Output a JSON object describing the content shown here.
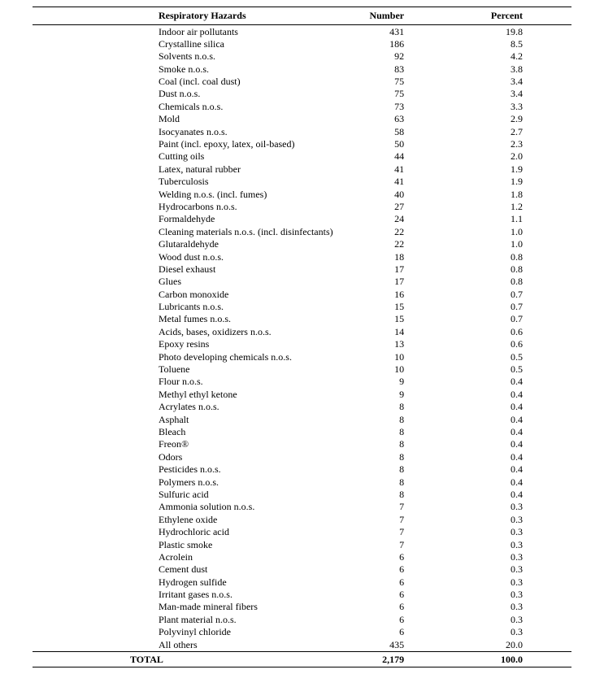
{
  "chart_data": {
    "type": "table",
    "headers": {
      "hazard": "Respiratory Hazards",
      "number": "Number",
      "percent": "Percent"
    },
    "rows": [
      {
        "hazard": "Indoor air pollutants",
        "number": "431",
        "percent": "19.8"
      },
      {
        "hazard": "Crystalline silica",
        "number": "186",
        "percent": "8.5"
      },
      {
        "hazard": "Solvents n.o.s.",
        "number": "92",
        "percent": "4.2"
      },
      {
        "hazard": "Smoke n.o.s.",
        "number": "83",
        "percent": "3.8"
      },
      {
        "hazard": "Coal (incl. coal dust)",
        "number": "75",
        "percent": "3.4"
      },
      {
        "hazard": "Dust n.o.s.",
        "number": "75",
        "percent": "3.4"
      },
      {
        "hazard": "Chemicals n.o.s.",
        "number": "73",
        "percent": "3.3"
      },
      {
        "hazard": "Mold",
        "number": "63",
        "percent": "2.9"
      },
      {
        "hazard": "Isocyanates n.o.s.",
        "number": "58",
        "percent": "2.7"
      },
      {
        "hazard": "Paint (incl. epoxy, latex, oil-based)",
        "number": "50",
        "percent": "2.3"
      },
      {
        "hazard": "Cutting oils",
        "number": "44",
        "percent": "2.0"
      },
      {
        "hazard": "Latex, natural rubber",
        "number": "41",
        "percent": "1.9"
      },
      {
        "hazard": "Tuberculosis",
        "number": "41",
        "percent": "1.9"
      },
      {
        "hazard": "Welding n.o.s. (incl. fumes)",
        "number": "40",
        "percent": "1.8"
      },
      {
        "hazard": "Hydrocarbons n.o.s.",
        "number": "27",
        "percent": "1.2"
      },
      {
        "hazard": "Formaldehyde",
        "number": "24",
        "percent": "1.1"
      },
      {
        "hazard": "Cleaning materials n.o.s. (incl. disinfectants)",
        "number": "22",
        "percent": "1.0"
      },
      {
        "hazard": "Glutaraldehyde",
        "number": "22",
        "percent": "1.0"
      },
      {
        "hazard": "Wood dust  n.o.s.",
        "number": "18",
        "percent": "0.8"
      },
      {
        "hazard": "Diesel exhaust",
        "number": "17",
        "percent": "0.8"
      },
      {
        "hazard": "Glues",
        "number": "17",
        "percent": "0.8"
      },
      {
        "hazard": "Carbon monoxide",
        "number": "16",
        "percent": "0.7"
      },
      {
        "hazard": "Lubricants n.o.s.",
        "number": "15",
        "percent": "0.7"
      },
      {
        "hazard": "Metal fumes n.o.s.",
        "number": "15",
        "percent": "0.7"
      },
      {
        "hazard": "Acids, bases, oxidizers n.o.s.",
        "number": "14",
        "percent": "0.6"
      },
      {
        "hazard": "Epoxy resins",
        "number": "13",
        "percent": "0.6"
      },
      {
        "hazard": "Photo developing chemicals n.o.s.",
        "number": "10",
        "percent": "0.5"
      },
      {
        "hazard": "Toluene",
        "number": "10",
        "percent": "0.5"
      },
      {
        "hazard": "Flour n.o.s.",
        "number": "9",
        "percent": "0.4"
      },
      {
        "hazard": "Methyl ethyl ketone",
        "number": "9",
        "percent": "0.4"
      },
      {
        "hazard": "Acrylates n.o.s.",
        "number": "8",
        "percent": "0.4"
      },
      {
        "hazard": "Asphalt",
        "number": "8",
        "percent": "0.4"
      },
      {
        "hazard": "Bleach",
        "number": "8",
        "percent": "0.4"
      },
      {
        "hazard": "Freon®",
        "number": "8",
        "percent": "0.4"
      },
      {
        "hazard": "Odors",
        "number": "8",
        "percent": "0.4"
      },
      {
        "hazard": "Pesticides n.o.s.",
        "number": "8",
        "percent": "0.4"
      },
      {
        "hazard": "Polymers n.o.s.",
        "number": "8",
        "percent": "0.4"
      },
      {
        "hazard": "Sulfuric acid",
        "number": "8",
        "percent": "0.4"
      },
      {
        "hazard": "Ammonia solution n.o.s.",
        "number": "7",
        "percent": "0.3"
      },
      {
        "hazard": "Ethylene oxide",
        "number": "7",
        "percent": "0.3"
      },
      {
        "hazard": "Hydrochloric acid",
        "number": "7",
        "percent": "0.3"
      },
      {
        "hazard": "Plastic smoke",
        "number": "7",
        "percent": "0.3"
      },
      {
        "hazard": "Acrolein",
        "number": "6",
        "percent": "0.3"
      },
      {
        "hazard": "Cement dust",
        "number": "6",
        "percent": "0.3"
      },
      {
        "hazard": "Hydrogen sulfide",
        "number": "6",
        "percent": "0.3"
      },
      {
        "hazard": "Irritant gases n.o.s.",
        "number": "6",
        "percent": "0.3"
      },
      {
        "hazard": "Man-made mineral fibers",
        "number": "6",
        "percent": "0.3"
      },
      {
        "hazard": "Plant material n.o.s.",
        "number": "6",
        "percent": "0.3"
      },
      {
        "hazard": "Polyvinyl chloride",
        "number": "6",
        "percent": "0.3"
      },
      {
        "hazard": "All others",
        "number": "435",
        "percent": "20.0"
      }
    ],
    "total": {
      "label": "TOTAL",
      "number": "2,179",
      "percent": "100.0"
    }
  }
}
